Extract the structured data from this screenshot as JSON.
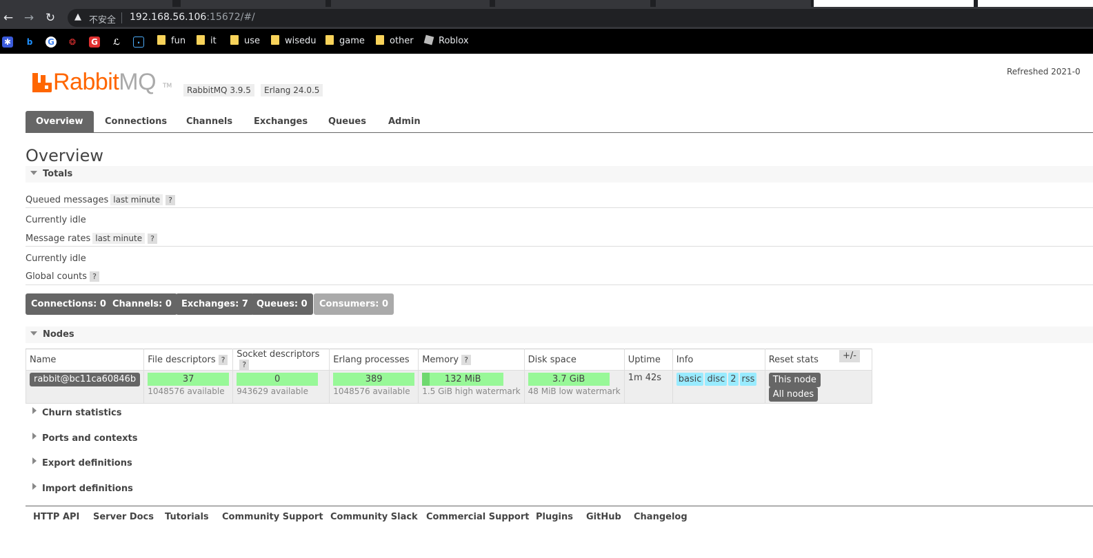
{
  "browser": {
    "url_host": "192.168.56.106",
    "url_path": ":15672/#/",
    "security_label": "不安全",
    "bookmarks": [
      "fun",
      "it",
      "use",
      "wisedu",
      "game",
      "other",
      "Roblox"
    ]
  },
  "header": {
    "brand_main": "Rabbit",
    "brand_mq": "MQ",
    "tm": "TM",
    "version": "RabbitMQ 3.9.5",
    "erlang": "Erlang 24.0.5",
    "refreshed": "Refreshed 2021-0"
  },
  "nav": {
    "tabs": [
      "Overview",
      "Connections",
      "Channels",
      "Exchanges",
      "Queues",
      "Admin"
    ],
    "selected": "Overview"
  },
  "page_title": "Overview",
  "totals": {
    "heading": "Totals",
    "queued_label": "Queued messages",
    "queued_range": "last minute",
    "help": "?",
    "queued_status": "Currently idle",
    "rates_label": "Message rates",
    "rates_range": "last minute",
    "rates_status": "Currently idle",
    "global_label": "Global counts",
    "counts": [
      {
        "label": "Connections:",
        "value": "0"
      },
      {
        "label": "Channels:",
        "value": "0"
      },
      {
        "label": "Exchanges:",
        "value": "7"
      },
      {
        "label": "Queues:",
        "value": "0"
      },
      {
        "label": "Consumers:",
        "value": "0"
      }
    ]
  },
  "nodes": {
    "heading": "Nodes",
    "columns": [
      "Name",
      "File descriptors",
      "Socket descriptors",
      "Erlang processes",
      "Memory",
      "Disk space",
      "Uptime",
      "Info",
      "Reset stats"
    ],
    "plus_minus": "+/-",
    "row": {
      "name": "rabbit@bc11ca60846b",
      "file_descriptors": "37",
      "file_descriptors_sub": "1048576 available",
      "socket_descriptors": "0",
      "socket_descriptors_sub": "943629 available",
      "erlang_processes": "389",
      "erlang_processes_sub": "1048576 available",
      "memory": "132 MiB",
      "memory_sub": "1.5 GiB high watermark",
      "memory_fraction": 0.086,
      "disk": "3.7 GiB",
      "disk_sub": "48 MiB low watermark",
      "uptime": "1m 42s",
      "info_tags": [
        "basic",
        "disc",
        "2",
        "rss"
      ],
      "reset_buttons": [
        "This node",
        "All nodes"
      ]
    }
  },
  "collapsed_sections": [
    "Churn statistics",
    "Ports and contexts",
    "Export definitions",
    "Import definitions"
  ],
  "footer_links": [
    "HTTP API",
    "Server Docs",
    "Tutorials",
    "Community Support",
    "Community Slack",
    "Commercial Support",
    "Plugins",
    "GitHub",
    "Changelog"
  ],
  "colors": {
    "brand_orange": "#ff6600",
    "bar_green": "#98f898",
    "tag_blue": "#99ebff",
    "dark_gray": "#666666"
  }
}
